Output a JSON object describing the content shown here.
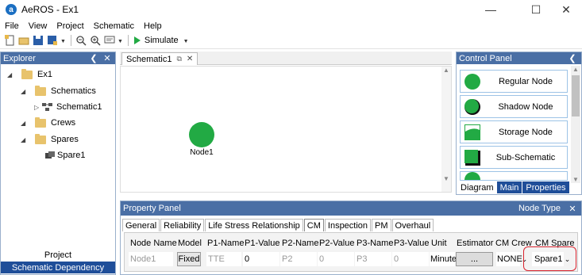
{
  "app": {
    "logo_letter": "a",
    "title": "AeROS - Ex1"
  },
  "window_controls": {
    "minimize": "—",
    "maximize": "☐",
    "close": "✕"
  },
  "menu": [
    "File",
    "View",
    "Project",
    "Schematic",
    "Help"
  ],
  "toolbar": {
    "simulate_label": "Simulate"
  },
  "explorer": {
    "title": "Explorer",
    "tree": {
      "root": "Ex1",
      "schematics": "Schematics",
      "schematic1": "Schematic1",
      "crews": "Crews",
      "spares": "Spares",
      "spare1": "Spare1"
    },
    "tabs": {
      "project": "Project",
      "schematic_dependency": "Schematic Dependency"
    }
  },
  "schematic": {
    "tab_label": "Schematic1",
    "node_label": "Node1",
    "node_color": "#22aa44"
  },
  "control_panel": {
    "title": "Control Panel",
    "items": [
      "Regular Node",
      "Shadow Node",
      "Storage Node",
      "Sub-Schematic"
    ],
    "tabs": [
      "Diagram",
      "Main",
      "Properties"
    ]
  },
  "property_panel": {
    "title": "Property Panel",
    "node_type_label": "Node Type",
    "tabs": [
      "General",
      "Reliability",
      "Life Stress Relationship",
      "CM",
      "Inspection",
      "PM",
      "Overhaul"
    ],
    "columns": [
      "Node Name",
      "Model",
      "P1-Name",
      "P1-Value",
      "P2-Name",
      "P2-Value",
      "P3-Name",
      "P3-Value",
      "Unit",
      "Estimator",
      "CM Crew",
      "CM Spare"
    ],
    "row": {
      "node_name": "Node1",
      "model": "Fixed",
      "p1_name": "TTE",
      "p1_value": "0",
      "p2_name": "P2",
      "p2_value": "0",
      "p3_name": "P3",
      "p3_value": "0",
      "unit": "Minute",
      "estimator": "...",
      "cm_crew": "NONE",
      "cm_spare": "Spare1"
    }
  },
  "colors": {
    "accent": "#4a6fa5",
    "selected_tab": "#1f4e99",
    "node_green": "#22aa44",
    "highlight_red": "#d9232e"
  }
}
